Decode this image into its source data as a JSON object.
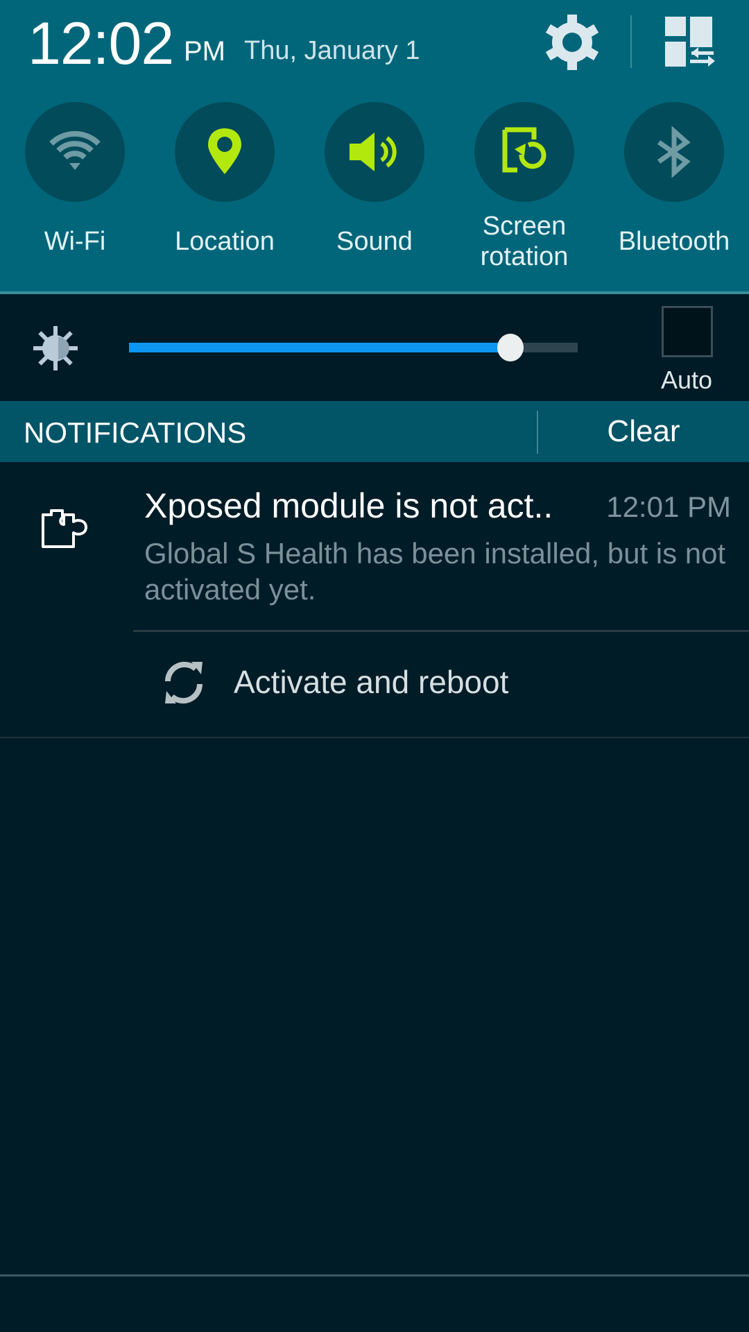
{
  "status": {
    "time": "12:02",
    "ampm": "PM",
    "date": "Thu, January 1",
    "settings_icon": "gear-icon",
    "edit_toggles_icon": "grid-swap-icon"
  },
  "toggles": [
    {
      "label": "Wi-Fi",
      "label2": "",
      "icon": "wifi-icon",
      "on": false
    },
    {
      "label": "Location",
      "label2": "",
      "icon": "location-pin-icon",
      "on": true
    },
    {
      "label": "Sound",
      "label2": "",
      "icon": "speaker-icon",
      "on": true
    },
    {
      "label": "Screen",
      "label2": "rotation",
      "icon": "screen-rotation-icon",
      "on": true
    },
    {
      "label": "Bluetooth",
      "label2": "",
      "icon": "bluetooth-icon",
      "on": false
    }
  ],
  "brightness": {
    "level_fraction": 0.85,
    "auto_label": "Auto",
    "auto_checked": false,
    "icon": "brightness-icon"
  },
  "notifications_bar": {
    "title": "NOTIFICATIONS",
    "clear_label": "Clear"
  },
  "notifications": [
    {
      "icon": "puzzle-piece-icon",
      "title": "Xposed module is not act..",
      "time": "12:01 PM",
      "body": "Global S Health has been installed, but is not activated yet.",
      "action": {
        "icon": "sync-icon",
        "label": "Activate and reboot"
      }
    }
  ],
  "colors": {
    "header_bg": "#02667a",
    "toggle_on": "#b3e80f",
    "toggle_off": "#6e9ba4",
    "slider_fill": "#0d96f2",
    "panel_bg": "#001c27"
  }
}
